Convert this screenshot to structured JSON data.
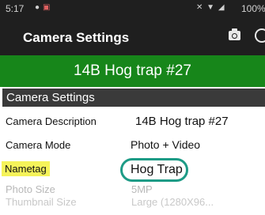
{
  "status_bar": {
    "time": "5:17",
    "battery": "100%"
  },
  "app_bar": {
    "title": "Camera Settings",
    "icons": [
      "camera-icon",
      "refresh-icon"
    ]
  },
  "banner": {
    "text": "14B Hog trap #27",
    "color": "#17861a"
  },
  "section": {
    "header": "Camera Settings"
  },
  "rows": [
    {
      "label": "Camera Description",
      "value": "14B Hog trap #27"
    },
    {
      "label": "Camera Mode",
      "value": "Photo + Video"
    },
    {
      "label": "Nametag",
      "value": "Hog Trap"
    },
    {
      "label": "Photo Size",
      "value": "5MP"
    },
    {
      "label": "Thumbnail Size",
      "value": "Large (1280X96..."
    }
  ],
  "highlight_color": "#f5f35a",
  "circle_color": "#1d9b86"
}
